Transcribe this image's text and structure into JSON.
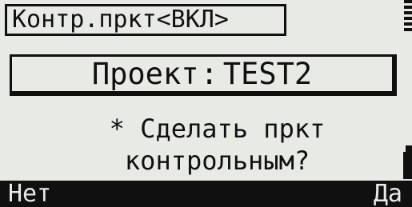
{
  "screen": {
    "title": "Контр.пркт<ВКЛ>",
    "project_label": "Проект",
    "project_separator": ":",
    "project_value": "TEST2",
    "question_line1": "* Сделать пркт",
    "question_line2": "контрольным?"
  },
  "softkeys": {
    "left_label": "Нет",
    "right_label": "Да"
  },
  "colors": {
    "lcd_background": "#e8eae6",
    "lcd_foreground": "#101010"
  },
  "icons": {
    "battery_indicator": "battery-icon",
    "scroll_indicator": "scroll-indicator-icon"
  }
}
